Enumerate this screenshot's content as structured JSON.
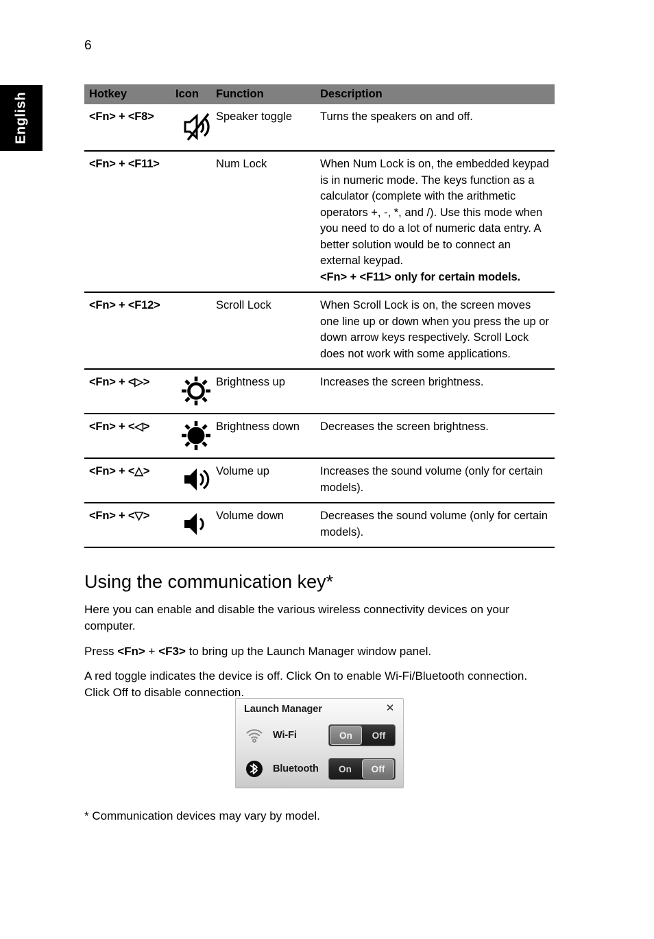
{
  "page": {
    "number": "6",
    "language_tab": "English"
  },
  "hotkey_table": {
    "headers": {
      "hotkey": "Hotkey",
      "icon": "Icon",
      "function": "Function",
      "description": "Description"
    },
    "rows": [
      {
        "hotkey": "<Fn> + <F8>",
        "icon": "speaker-mute-icon",
        "function": "Speaker toggle",
        "description": "Turns the speakers on and off.",
        "description_bold": ""
      },
      {
        "hotkey": "<Fn> + <F11>",
        "icon": "",
        "function": "Num Lock",
        "description": "When Num Lock is on, the embedded keypad is in numeric mode. The keys function as a calculator (complete with the arithmetic operators +, -, *, and /). Use this mode when you need to do a lot of numeric data entry. A better solution would be to connect an external keypad.",
        "description_bold": "<Fn> + <F11> only for certain models."
      },
      {
        "hotkey": "<Fn> + <F12>",
        "icon": "",
        "function": "Scroll Lock",
        "description": "When Scroll Lock is on, the screen moves one line up or down when you press the up or down arrow keys respectively. Scroll Lock does not work with some applications.",
        "description_bold": ""
      },
      {
        "hotkey": "<Fn> + <▷>",
        "icon": "brightness-up-sun-icon",
        "function": "Brightness up",
        "description": "Increases the screen brightness.",
        "description_bold": ""
      },
      {
        "hotkey": "<Fn> + <◁>",
        "icon": "brightness-down-sun-icon",
        "function": "Brightness down",
        "description": "Decreases the screen brightness.",
        "description_bold": ""
      },
      {
        "hotkey": "<Fn> + <△>",
        "icon": "volume-up-speaker-icon",
        "function": "Volume up",
        "description": "Increases the sound volume (only for certain models).",
        "description_bold": ""
      },
      {
        "hotkey": "<Fn> + <▽>",
        "icon": "volume-down-speaker-icon",
        "function": "Volume down",
        "description": "Decreases the sound volume (only for certain models).",
        "description_bold": ""
      }
    ]
  },
  "section": {
    "heading": "Using the communication key*",
    "paragraph_1": "Here you can enable and disable the various wireless connectivity devices on your computer.",
    "paragraph_2_prefix": "Press ",
    "paragraph_2_key_1": "<Fn>",
    "paragraph_2_mid": " + ",
    "paragraph_2_key_2": "<F3>",
    "paragraph_2_suffix": " to bring up the Launch Manager window panel.",
    "paragraph_3": "A red toggle indicates the device is off. Click On to enable Wi-Fi/Bluetooth connection. Click Off to disable connection.",
    "footnote": "* Communication devices may vary by model."
  },
  "launch_manager": {
    "title": "Launch Manager",
    "close_icon": "close-icon",
    "devices": [
      {
        "name": "Wi-Fi",
        "icon": "wifi-icon",
        "on_label": "On",
        "off_label": "Off",
        "selected": "On"
      },
      {
        "name": "Bluetooth",
        "icon": "bluetooth-icon",
        "on_label": "On",
        "off_label": "Off",
        "selected": "Off"
      }
    ]
  },
  "colors": {
    "table_header_bg": "#808080",
    "language_tab_bg": "#000000",
    "toggle_track": "#252525",
    "toggle_active": "#868686"
  }
}
